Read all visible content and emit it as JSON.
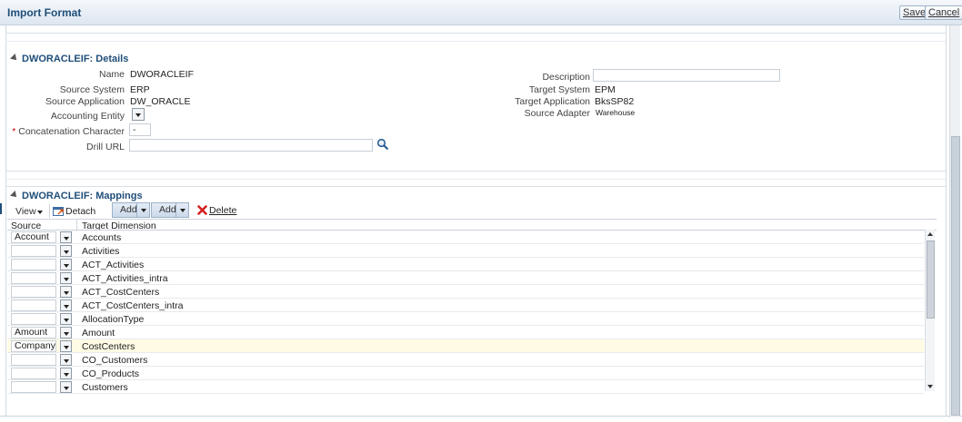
{
  "window": {
    "title": "Import Format",
    "save_label": "Save",
    "cancel_label": "Cancel"
  },
  "details": {
    "header": "DWORACLEIF: Details",
    "name_label": "Name",
    "name_value": "DWORACLEIF",
    "source_system_label": "Source System",
    "source_system_value": "ERP",
    "source_application_label": "Source Application",
    "source_application_value": "DW_ORACLE",
    "accounting_entity_label": "Accounting Entity",
    "concatenation_label": "Concatenation Character",
    "concatenation_required": "*",
    "concatenation_value": "-",
    "drill_url_label": "Drill URL",
    "drill_url_value": "",
    "description_label": "Description",
    "description_value": "",
    "target_system_label": "Target System",
    "target_system_value": "EPM",
    "target_application_label": "Target Application",
    "target_application_value": "BksSP82",
    "source_adapter_label": "Source Adapter",
    "source_adapter_value": "Warehouse"
  },
  "mappings": {
    "header": "DWORACLEIF: Mappings",
    "toolbar": {
      "view_label": "View",
      "detach_label": "Detach",
      "add1_label": "Add",
      "add2_label": "Add",
      "delete_label": "Delete"
    },
    "columns": [
      "Source",
      "Target Dimension"
    ],
    "rows": [
      {
        "source": "Account",
        "target": "Accounts"
      },
      {
        "source": "",
        "target": "Activities"
      },
      {
        "source": "",
        "target": "ACT_Activities"
      },
      {
        "source": "",
        "target": "ACT_Activities_intra"
      },
      {
        "source": "",
        "target": "ACT_CostCenters"
      },
      {
        "source": "",
        "target": "ACT_CostCenters_intra"
      },
      {
        "source": "",
        "target": "AllocationType"
      },
      {
        "source": "Amount",
        "target": "Amount"
      },
      {
        "source": "Company",
        "target": "CostCenters"
      },
      {
        "source": "",
        "target": "CO_Customers"
      },
      {
        "source": "",
        "target": "CO_Products"
      },
      {
        "source": "",
        "target": "Customers"
      }
    ]
  },
  "colors": {
    "title": "#1f4e79",
    "highlight_row": "#fffbe4",
    "delete_icon": "#d42020"
  },
  "icons": [
    "search-icon",
    "detach-icon",
    "delete-icon",
    "collapse-icon"
  ]
}
